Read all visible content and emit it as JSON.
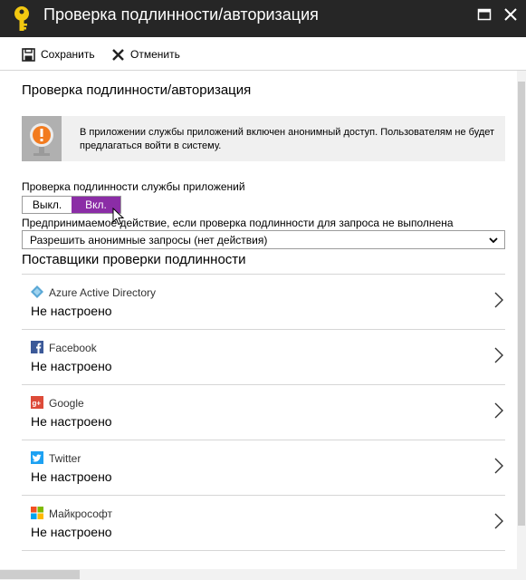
{
  "window": {
    "title": "Проверка подлинности/авторизация"
  },
  "toolbar": {
    "save_label": "Сохранить",
    "cancel_label": "Отменить"
  },
  "section": {
    "title": "Проверка подлинности/авторизация"
  },
  "info": {
    "text": "В приложении службы приложений включен анонимный доступ. Пользователям не будет предлагаться войти в систему."
  },
  "auth": {
    "label": "Проверка подлинности службы приложений",
    "off_label": "Выкл.",
    "on_label": "Вкл.",
    "selected": "Вкл."
  },
  "action": {
    "label": "Предпринимаемое действие, если проверка подлинности для запроса не выполнена",
    "selected": "Разрешить анонимные запросы (нет действия)"
  },
  "providers": {
    "title": "Поставщики проверки подлинности",
    "items": [
      {
        "name": "Azure Active Directory",
        "status": "Не настроено",
        "icon": "azure-ad-icon",
        "color": "#5aa8d6"
      },
      {
        "name": "Facebook",
        "status": "Не настроено",
        "icon": "facebook-icon",
        "color": "#3b5998"
      },
      {
        "name": "Google",
        "status": "Не настроено",
        "icon": "google-plus-icon",
        "color": "#dd4b39"
      },
      {
        "name": "Twitter",
        "status": "Не настроено",
        "icon": "twitter-icon",
        "color": "#1da1f2"
      },
      {
        "name": "Майкрософт",
        "status": "Не настроено",
        "icon": "microsoft-icon",
        "color": "#f25022"
      }
    ]
  },
  "colors": {
    "titlebar": "#262626",
    "toggle_on": "#8b2da6",
    "key": "#f2c811",
    "warning": "#f27b1f"
  }
}
